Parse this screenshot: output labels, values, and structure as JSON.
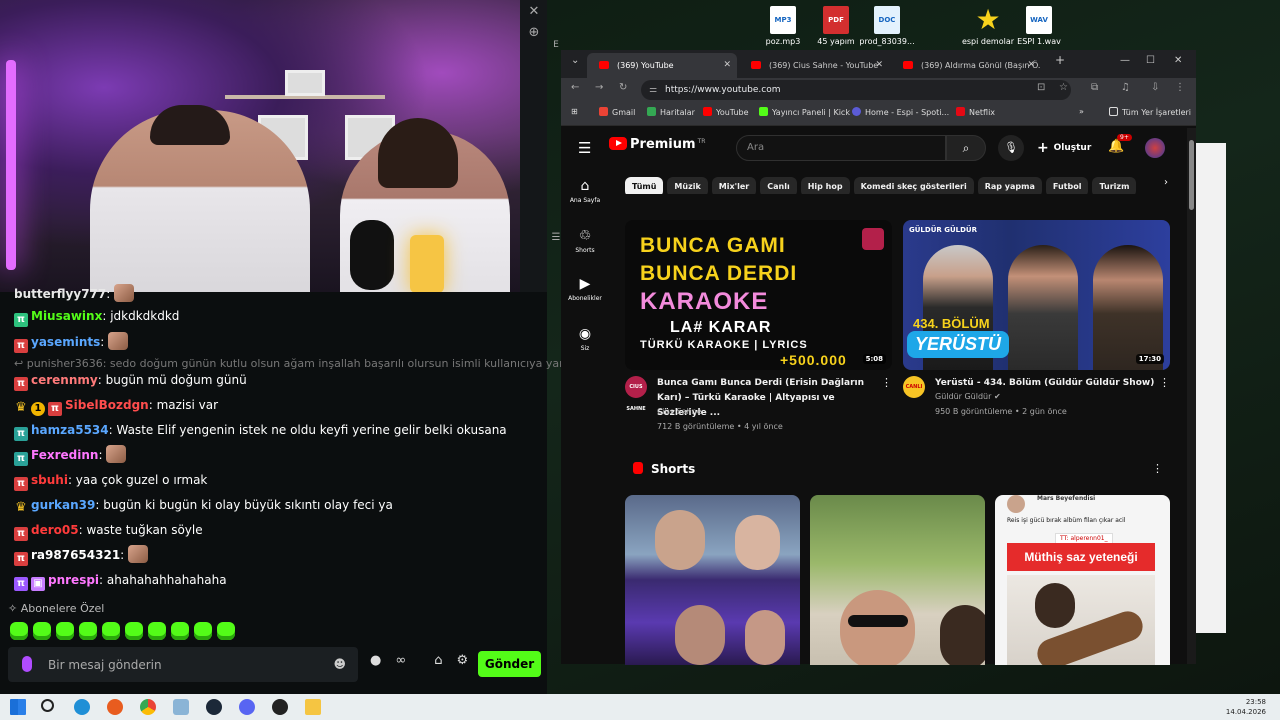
{
  "desktop": {
    "icons": [
      {
        "label": "poz.mp3",
        "type": "MP3"
      },
      {
        "label": "45 yapım",
        "type": "PDF"
      },
      {
        "label": "prod_83039...",
        "type": "DOC"
      },
      {
        "label": "espi demolar",
        "type": "star"
      },
      {
        "label": "ESPI 1.wav",
        "type": "WAV"
      }
    ]
  },
  "kick": {
    "chat_messages": [
      {
        "user": "butterflyy777",
        "text": "",
        "badges": [
          "red"
        ],
        "color": "#e8e8e8"
      },
      {
        "user": "Miusawinx",
        "text": "jdkdkdkdkd",
        "badges": [
          "green"
        ],
        "color": "#53fc18"
      },
      {
        "user": "yasemints",
        "text": "",
        "badges": [
          "red"
        ],
        "color": "#5aa7ff"
      },
      {
        "user": "cerennmy",
        "text": "bugün mü doğum günü",
        "badges": [
          "red"
        ],
        "color": "#ff7a7a"
      },
      {
        "user": "SibelBozdgn",
        "text": "mazisi var",
        "badges": [
          "crown",
          "coin",
          "red"
        ],
        "color": "#ff4d4d"
      },
      {
        "user": "hamza5534",
        "text": "Waste Elif yengenin istek ne oldu keyfi yerine gelir belki okusana",
        "badges": [
          "teal"
        ],
        "color": "#5aa7ff"
      },
      {
        "user": "Fexredinn",
        "text": "",
        "badges": [
          "teal"
        ],
        "color": "#ff77ff"
      },
      {
        "user": "sbuhi",
        "text": "yaa çok guzel o ırmak",
        "badges": [
          "red"
        ],
        "color": "#ff3b3b"
      },
      {
        "user": "gurkan39",
        "text": "bugün ki bugün ki olay büyük sıkıntı olay feci ya",
        "badges": [
          "crown"
        ],
        "color": "#5aa7ff"
      },
      {
        "user": "dero05",
        "text": "waste tuğkan söyle",
        "badges": [
          "red"
        ],
        "color": "#ff3b3b"
      },
      {
        "user": "ra987654321",
        "text": "",
        "badges": [
          "red"
        ],
        "color": "#ffffff"
      },
      {
        "user": "pnrespi",
        "text": "ahahahahhahahaha",
        "badges": [
          "purple",
          "gift"
        ],
        "color": "#ff77ff"
      }
    ],
    "reply_preview": "punisher3636: sedo doğum günün kutlu olsun ağam inşallah başarılı olursun isimli kullanıcıya yanıt veri...",
    "subs_label": "Abonelere Özel",
    "input_placeholder": "Bir mesaj gönderin",
    "send_label": "Gönder",
    "tools_infinity": "∞"
  },
  "chrome": {
    "tabs": [
      {
        "label": "(369) YouTube",
        "active": true
      },
      {
        "label": "(369) Cius Sahne - YouTube",
        "active": false
      },
      {
        "label": "(369) Aldırma Gönül (Başın Ö...",
        "active": false
      }
    ],
    "url": "https://www.youtube.com",
    "bookmarks": [
      {
        "label": "Gmail",
        "color": "#ea4335"
      },
      {
        "label": "Haritalar",
        "color": "#34a853"
      },
      {
        "label": "YouTube",
        "color": "#ff0000"
      },
      {
        "label": "Yayıncı Paneli | Kick",
        "color": "#53fc18"
      },
      {
        "label": "Home - Espi - Spoti...",
        "color": "#5b5bd6"
      },
      {
        "label": "Netflix",
        "color": "#e50914"
      }
    ],
    "all_bookmarks": "Tüm Yer İşaretleri"
  },
  "youtube": {
    "logo_text": "Premium",
    "region": "TR",
    "search_placeholder": "Ara",
    "create_label": "Oluştur",
    "notif_count": "9+",
    "guide": [
      {
        "label": "Ana Sayfa",
        "icon": "home-icon"
      },
      {
        "label": "Shorts",
        "icon": "shorts-icon"
      },
      {
        "label": "Abonelikler",
        "icon": "subscriptions-icon"
      },
      {
        "label": "Siz",
        "icon": "you-icon"
      }
    ],
    "chips": [
      "Tümü",
      "Müzik",
      "Mix'ler",
      "Canlı",
      "Hip hop",
      "Komedi skeç gösterileri",
      "Rap yapma",
      "Futbol",
      "Turizm"
    ],
    "videos": [
      {
        "title": "Bunca Gamı Bunca Derdi (Erisin Dağların Karı) – Türkü Karaoke | Altyapısı ve Sözleriyle ...",
        "channel": "Cius Sahne",
        "meta": "712 B görüntüleme • 4 yıl önce",
        "duration": "5:08",
        "thumb_lines": [
          "BUNCA GAMI",
          "BUNCA DERDI",
          "KARAOKE",
          "LA# KARAR",
          "TÜRKÜ KARAOKE | LYRICS",
          "+500.000"
        ],
        "avatar_text": "CIUS SAHNE"
      },
      {
        "title": "Yerüstü - 434. Bölüm (Güldür Güldür Show)",
        "channel": "Güldür Güldür",
        "meta": "950 B görüntüleme • 2 gün önce",
        "duration": "17:30",
        "thumb_lines": [
          "434. BÖLÜM",
          "YERÜSTÜ",
          "GÜLDÜR GÜLDÜR"
        ],
        "avatar_text": "CANLI"
      }
    ],
    "shorts_title": "Shorts",
    "shorts": [
      {
        "caption": ""
      },
      {
        "caption": ""
      },
      {
        "header": "Mars Beyefendisi",
        "line": "Reis işi gücü bırak albüm filan çıkar acil",
        "tag": "TT: alperenn01_",
        "headline": "Müthiş saz yeteneği"
      }
    ]
  },
  "taskbar": {
    "time": "23:58",
    "date": "14.04.2026"
  }
}
